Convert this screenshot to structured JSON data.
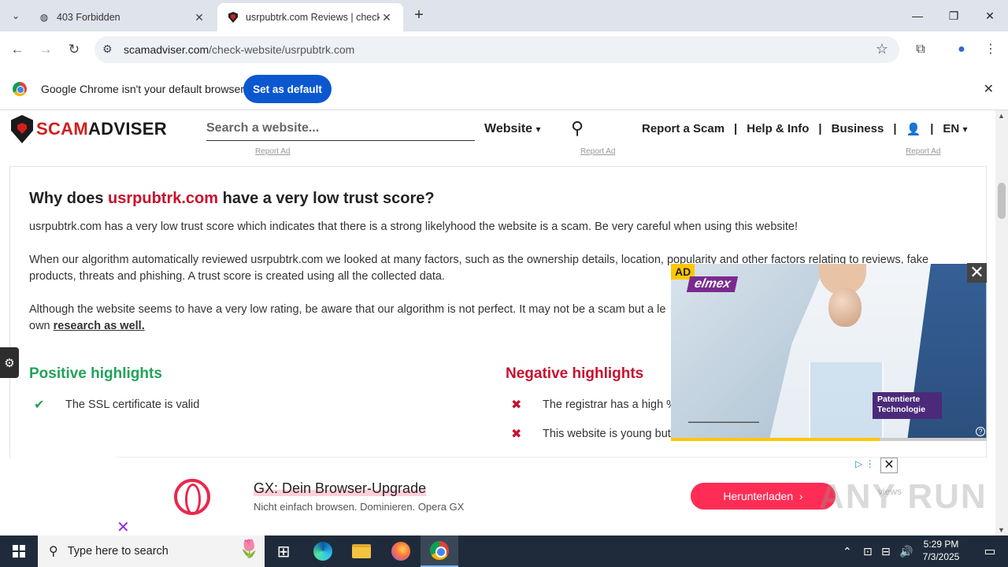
{
  "browser": {
    "tabs": [
      {
        "title": "403 Forbidden",
        "icon": "globe-icon"
      },
      {
        "title": "usrpubtrk.com Reviews | check",
        "icon": "scamadviser-shield-icon",
        "active": true
      }
    ],
    "url_host": "scamadviser.com",
    "url_path": "/check-website/usrpubtrk.com",
    "infobar_message": "Google Chrome isn't your default browser",
    "infobar_button": "Set as default"
  },
  "site": {
    "logo_part1": "SCAM",
    "logo_part2": "ADVISER",
    "search_placeholder": "Search a website...",
    "search_scope": "Website",
    "nav": [
      "Report a Scam",
      "Help & Info",
      "Business"
    ],
    "language": "EN",
    "report_ad": "Report Ad",
    "sep": "|"
  },
  "article": {
    "heading_pre": "Why does ",
    "heading_domain": "usrpubtrk.com",
    "heading_post": " have a very low trust score?",
    "p1": "usrpubtrk.com has a very low trust score which indicates that there is a strong likelyhood the website is a scam. Be very careful when using this website!",
    "p2": "When our algorithm automatically reviewed usrpubtrk.com we looked at many factors, such as the ownership details, location, popularity and other factors relating to reviews, fake products, threats and phishing. A trust score is created using all the collected data.",
    "p3_text": "Although the website seems to have a very low rating, be aware that our algorithm is not perfect. It may not be a scam but a le",
    "p3_line2": "own ",
    "p3_link": "research as well.",
    "positive_heading": "Positive highlights",
    "negative_heading": "Negative highlights",
    "positive": [
      "The SSL certificate is valid"
    ],
    "negative": [
      "The registrar has a high %",
      "This website is young but a"
    ]
  },
  "video_ad": {
    "badge": "AD",
    "brand": "elmex",
    "tag_line1": "Patentierte",
    "tag_line2": "Technologie",
    "progress": 0.66
  },
  "banner_ad": {
    "title": "GX: Dein Browser-Upgrade",
    "subtitle": "Nicht einfach browsen. Dominieren. Opera GX",
    "cta": "Herunterladen",
    "faded_text": "views"
  },
  "watermark": "ANY RUN",
  "taskbar": {
    "search_placeholder": "Type here to search",
    "time": "5:29 PM",
    "date": "7/3/2025"
  }
}
